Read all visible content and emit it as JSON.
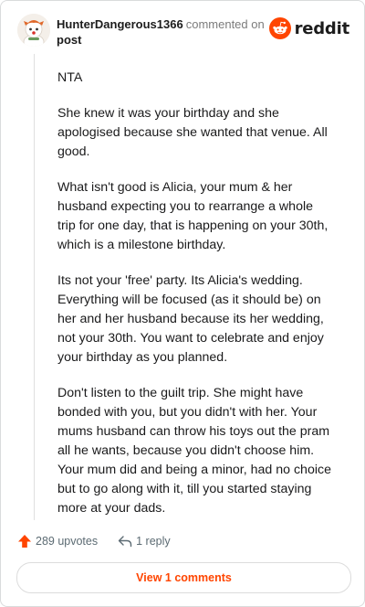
{
  "comment": {
    "username": "HunterDangerous1366",
    "action_text": "commented on",
    "post_link": "post",
    "paragraphs": [
      "NTA",
      "She knew it was your birthday and she apologised because she wanted that venue. All good.",
      "What isn't good is Alicia, your mum & her husband expecting you to rearrange a whole trip for one day, that is happening on your 30th, which is a milestone birthday.",
      "Its not your 'free' party. Its Alicia's wedding. Everything will be focused (as it should be) on her and her husband because its her wedding, not your 30th. You want to celebrate and enjoy your birthday as you planned.",
      "Don't listen to the guilt trip. She might have bonded with you, but you didn't with her. Your mums husband can throw his toys out the pram all he wants, because you didn't choose him. Your mum did and being a minor, had no choice but to go along with it, till you started staying more at your dads."
    ],
    "upvotes_label": "289 upvotes",
    "reply_label": "1 reply"
  },
  "brand": {
    "name": "reddit",
    "icon": "reddit-logo-icon",
    "color": "#ff4500"
  },
  "footer": {
    "view_comments_label": "View 1 comments"
  },
  "colors": {
    "accent": "#ff4500",
    "text": "#1a1a1b",
    "muted": "#7c7c7c"
  }
}
